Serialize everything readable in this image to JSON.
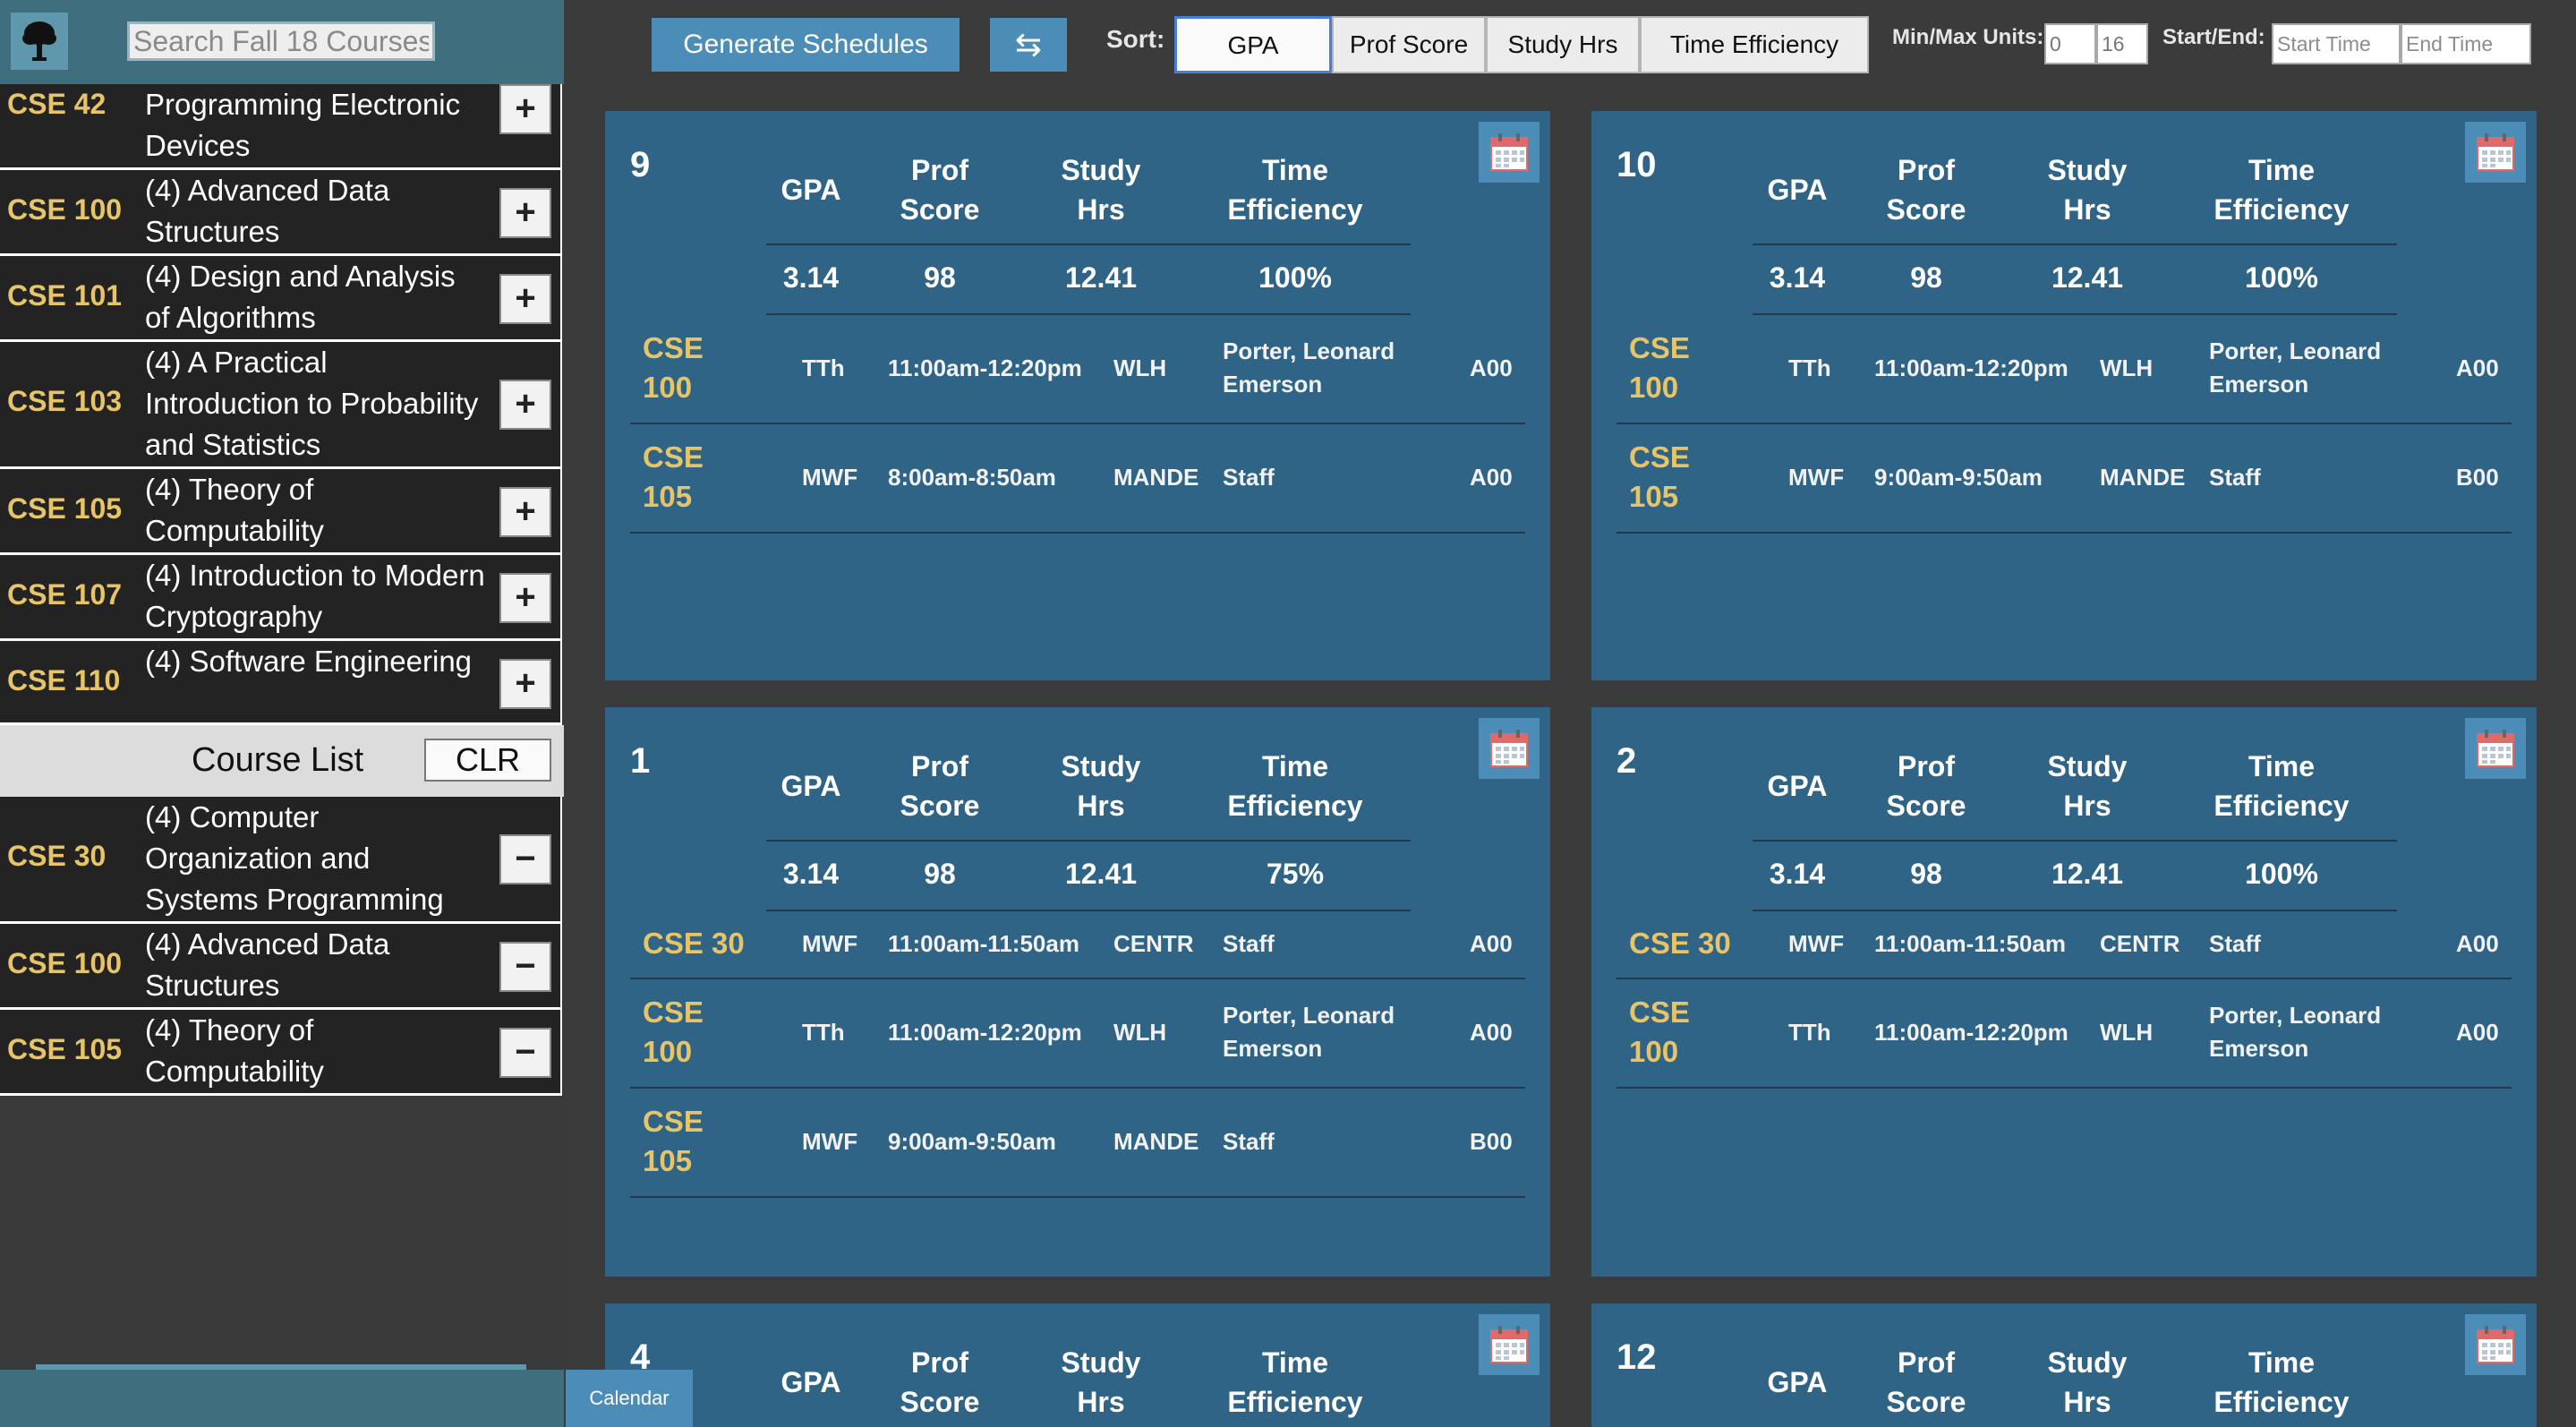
{
  "sidebar": {
    "search_placeholder": "Search Fall 18 Courses",
    "search_results": [
      {
        "code": "CSE 42",
        "title": "Programming Electronic Devices",
        "action": "+"
      },
      {
        "code": "CSE 100",
        "title": "(4) Advanced Data Structures",
        "action": "+"
      },
      {
        "code": "CSE 101",
        "title": "(4) Design and Analysis of Algorithms",
        "action": "+"
      },
      {
        "code": "CSE 103",
        "title": "(4) A Practical Introduction to Probability and Statistics",
        "action": "+"
      },
      {
        "code": "CSE 105",
        "title": "(4) Theory of Computability",
        "action": "+"
      },
      {
        "code": "CSE 107",
        "title": "(4) Introduction to Modern Cryptography",
        "action": "+"
      },
      {
        "code": "CSE 110",
        "title": "(4) Software Engineering",
        "action": "+"
      }
    ],
    "course_list_title": "Course List",
    "clear_label": "CLR",
    "course_list": [
      {
        "code": "CSE 30",
        "title": "(4) Computer Organization and Systems Programming",
        "action": "−"
      },
      {
        "code": "CSE 100",
        "title": "(4) Advanced Data Structures",
        "action": "−"
      },
      {
        "code": "CSE 105",
        "title": "(4) Theory of Computability",
        "action": "−"
      }
    ]
  },
  "toolbar": {
    "generate_label": "Generate Schedules",
    "swap_icon": "⇆",
    "sort_label": "Sort:",
    "sort_options": [
      "GPA",
      "Prof Score",
      "Study Hrs",
      "Time Efficiency"
    ],
    "sort_active": "GPA",
    "units_label": "Min/Max Units:",
    "min_units": "0",
    "max_units": "16",
    "startend_label": "Start/End:",
    "start_placeholder": "Start Time",
    "end_placeholder": "End Time"
  },
  "stat_headers": {
    "gpa": "GPA",
    "prof1": "Prof",
    "prof2": "Score",
    "study1": "Study",
    "study2": "Hrs",
    "time1": "Time",
    "time2": "Efficiency"
  },
  "schedules": [
    {
      "number": "9",
      "gpa": "3.14",
      "prof": "98",
      "study": "12.41",
      "time": "100%",
      "sections": [
        {
          "code1": "CSE",
          "code2": "100",
          "days": "TTh",
          "time": "11:00am-12:20pm",
          "bldg": "WLH",
          "prof1": "Porter, Leonard",
          "prof2": "Emerson",
          "sec": "A00"
        },
        {
          "code1": "CSE",
          "code2": "105",
          "days": "MWF",
          "time": "8:00am-8:50am",
          "bldg": "MANDE",
          "prof1": "Staff",
          "prof2": "",
          "sec": "A00"
        }
      ]
    },
    {
      "number": "10",
      "gpa": "3.14",
      "prof": "98",
      "study": "12.41",
      "time": "100%",
      "sections": [
        {
          "code1": "CSE",
          "code2": "100",
          "days": "TTh",
          "time": "11:00am-12:20pm",
          "bldg": "WLH",
          "prof1": "Porter, Leonard",
          "prof2": "Emerson",
          "sec": "A00"
        },
        {
          "code1": "CSE",
          "code2": "105",
          "days": "MWF",
          "time": "9:00am-9:50am",
          "bldg": "MANDE",
          "prof1": "Staff",
          "prof2": "",
          "sec": "B00"
        }
      ]
    },
    {
      "number": "1",
      "gpa": "3.14",
      "prof": "98",
      "study": "12.41",
      "time": "75%",
      "sections": [
        {
          "code1": "CSE 30",
          "code2": "",
          "days": "MWF",
          "time": "11:00am-11:50am",
          "bldg": "CENTR",
          "prof1": "Staff",
          "prof2": "",
          "sec": "A00"
        },
        {
          "code1": "CSE",
          "code2": "100",
          "days": "TTh",
          "time": "11:00am-12:20pm",
          "bldg": "WLH",
          "prof1": "Porter, Leonard",
          "prof2": "Emerson",
          "sec": "A00"
        },
        {
          "code1": "CSE",
          "code2": "105",
          "days": "MWF",
          "time": "9:00am-9:50am",
          "bldg": "MANDE",
          "prof1": "Staff",
          "prof2": "",
          "sec": "B00"
        }
      ]
    },
    {
      "number": "2",
      "gpa": "3.14",
      "prof": "98",
      "study": "12.41",
      "time": "100%",
      "sections": [
        {
          "code1": "CSE 30",
          "code2": "",
          "days": "MWF",
          "time": "11:00am-11:50am",
          "bldg": "CENTR",
          "prof1": "Staff",
          "prof2": "",
          "sec": "A00"
        },
        {
          "code1": "CSE",
          "code2": "100",
          "days": "TTh",
          "time": "11:00am-12:20pm",
          "bldg": "WLH",
          "prof1": "Porter, Leonard",
          "prof2": "Emerson",
          "sec": "A00"
        }
      ]
    },
    {
      "number": "4",
      "gpa": "",
      "prof": "",
      "study": "",
      "time": "",
      "sections": []
    },
    {
      "number": "12",
      "gpa": "",
      "prof": "",
      "study": "",
      "time": "",
      "sections": []
    }
  ],
  "calendar_tab_label": "Calendar"
}
